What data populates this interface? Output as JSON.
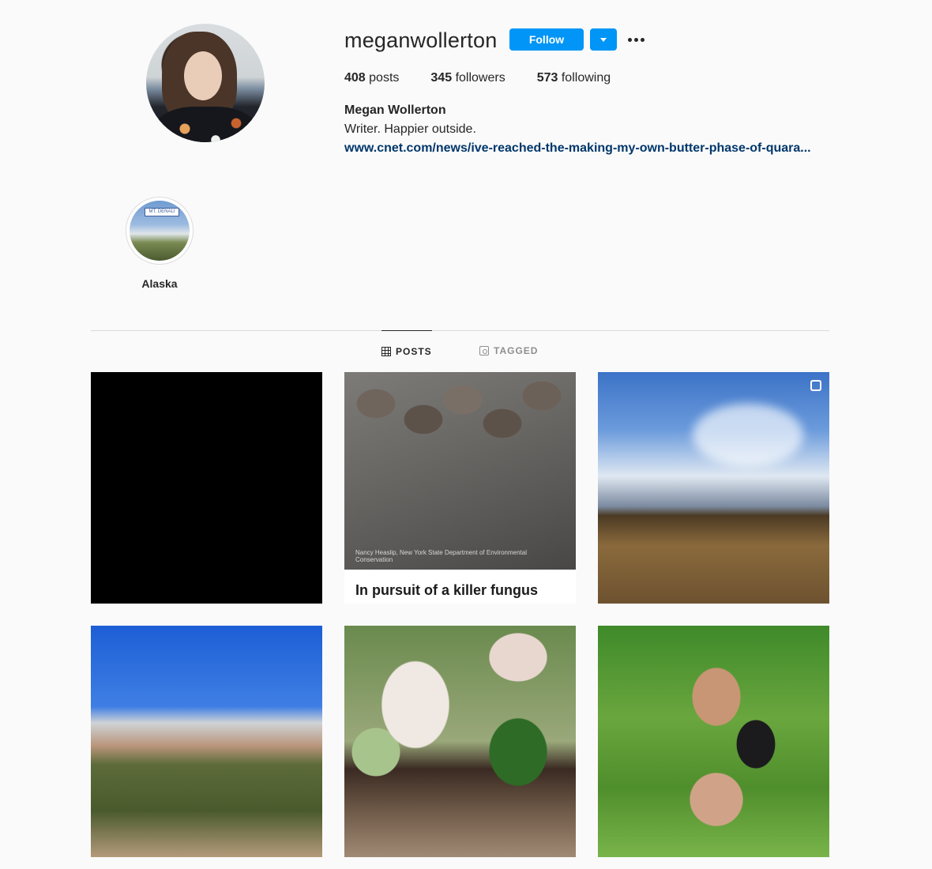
{
  "profile": {
    "username": "meganwollerton",
    "follow_label": "Follow",
    "stats": {
      "posts_count": "408",
      "posts_label": "posts",
      "followers_count": "345",
      "followers_label": "followers",
      "following_count": "573",
      "following_label": "following"
    },
    "full_name": "Megan Wollerton",
    "bio": "Writer. Happier outside.",
    "link": "www.cnet.com/news/ive-reached-the-making-my-own-butter-phase-of-quara..."
  },
  "highlights": [
    {
      "label": "Alaska",
      "sign_text": "MT. DENALI"
    }
  ],
  "tabs": {
    "posts_label": "POSTS",
    "tagged_label": "TAGGED",
    "active": "POSTS"
  },
  "posts": [
    {
      "caption": ""
    },
    {
      "credit": "Nancy Heaslip, New York State Department of Environmental Conservation",
      "caption": "In pursuit of a killer fungus"
    },
    {
      "caption": "",
      "multi": true
    },
    {
      "caption": ""
    },
    {
      "caption": ""
    },
    {
      "caption": ""
    }
  ],
  "colors": {
    "accent": "#0095f6",
    "link": "#00376b",
    "background": "#fafafa"
  }
}
